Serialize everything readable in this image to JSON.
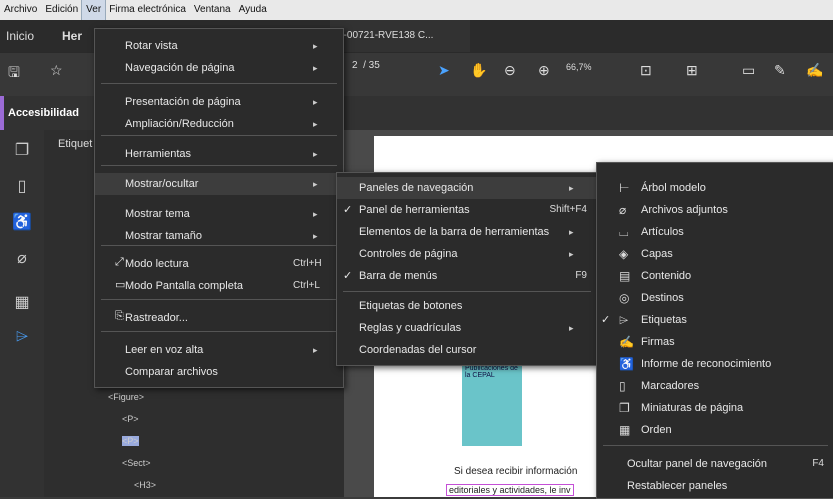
{
  "menubar": [
    "Archivo",
    "Edición",
    "Ver",
    "Firma electrónica",
    "Ventana",
    "Ayuda"
  ],
  "tabs": {
    "home": "Inicio",
    "tools": "Her",
    "doc": "2-00721-RVE138 C..."
  },
  "toolbar": {
    "page_current": "2",
    "page_total": "/ 35",
    "zoom": "66,7%"
  },
  "section_title": "Accesibilidad",
  "panel": {
    "label": "Etiquet"
  },
  "tree": [
    "<Figure>",
    "<P>",
    "<P>",
    "<Sect>",
    "<H3>"
  ],
  "page": {
    "pub_title": "Publicaciones de la CEPAL",
    "text1": "Si desea recibir información",
    "text2": "editoriales y actividades, le inv"
  },
  "ver_menu": [
    {
      "label": "Rotar vista",
      "sub": true
    },
    {
      "label": "Navegación de página",
      "sub": true
    },
    {
      "label": "Presentación de página",
      "sub": true
    },
    {
      "label": "Ampliación/Reducción",
      "sub": true
    },
    {
      "label": "Herramientas",
      "sub": true
    },
    {
      "label": "Mostrar/ocultar",
      "sub": true
    },
    {
      "label": "Mostrar tema",
      "sub": true
    },
    {
      "label": "Mostrar tamaño",
      "sub": true
    },
    {
      "label": "Modo lectura",
      "shortcut": "Ctrl+H"
    },
    {
      "label": "Modo Pantalla completa",
      "shortcut": "Ctrl+L"
    },
    {
      "label": "Rastreador..."
    },
    {
      "label": "Leer en voz alta",
      "sub": true
    },
    {
      "label": "Comparar archivos"
    }
  ],
  "show_menu": [
    {
      "label": "Paneles de navegación",
      "sub": true
    },
    {
      "label": "Panel de herramientas",
      "shortcut": "Shift+F4",
      "checked": true
    },
    {
      "label": "Elementos de la barra de herramientas",
      "sub": true
    },
    {
      "label": "Controles de página",
      "sub": true
    },
    {
      "label": "Barra de menús",
      "shortcut": "F9",
      "checked": true
    },
    {
      "label": "Etiquetas de botones"
    },
    {
      "label": "Reglas y cuadrículas",
      "sub": true
    },
    {
      "label": "Coordenadas del cursor"
    }
  ],
  "nav_menu": [
    {
      "label": "Árbol modelo",
      "icon": "tree-icon"
    },
    {
      "label": "Archivos adjuntos",
      "icon": "paperclip-icon"
    },
    {
      "label": "Artículos",
      "icon": "articles-icon"
    },
    {
      "label": "Capas",
      "icon": "layers-icon"
    },
    {
      "label": "Contenido",
      "icon": "content-icon"
    },
    {
      "label": "Destinos",
      "icon": "target-icon"
    },
    {
      "label": "Etiquetas",
      "icon": "tag-icon",
      "checked": true
    },
    {
      "label": "Firmas",
      "icon": "signature-icon"
    },
    {
      "label": "Informe de reconocimiento",
      "icon": "accessibility-icon"
    },
    {
      "label": "Marcadores",
      "icon": "bookmark-icon"
    },
    {
      "label": "Miniaturas de página",
      "icon": "thumbnails-icon"
    },
    {
      "label": "Orden",
      "icon": "order-icon"
    },
    {
      "label": "Ocultar panel de navegación",
      "shortcut": "F4"
    },
    {
      "label": "Restablecer paneles"
    }
  ]
}
